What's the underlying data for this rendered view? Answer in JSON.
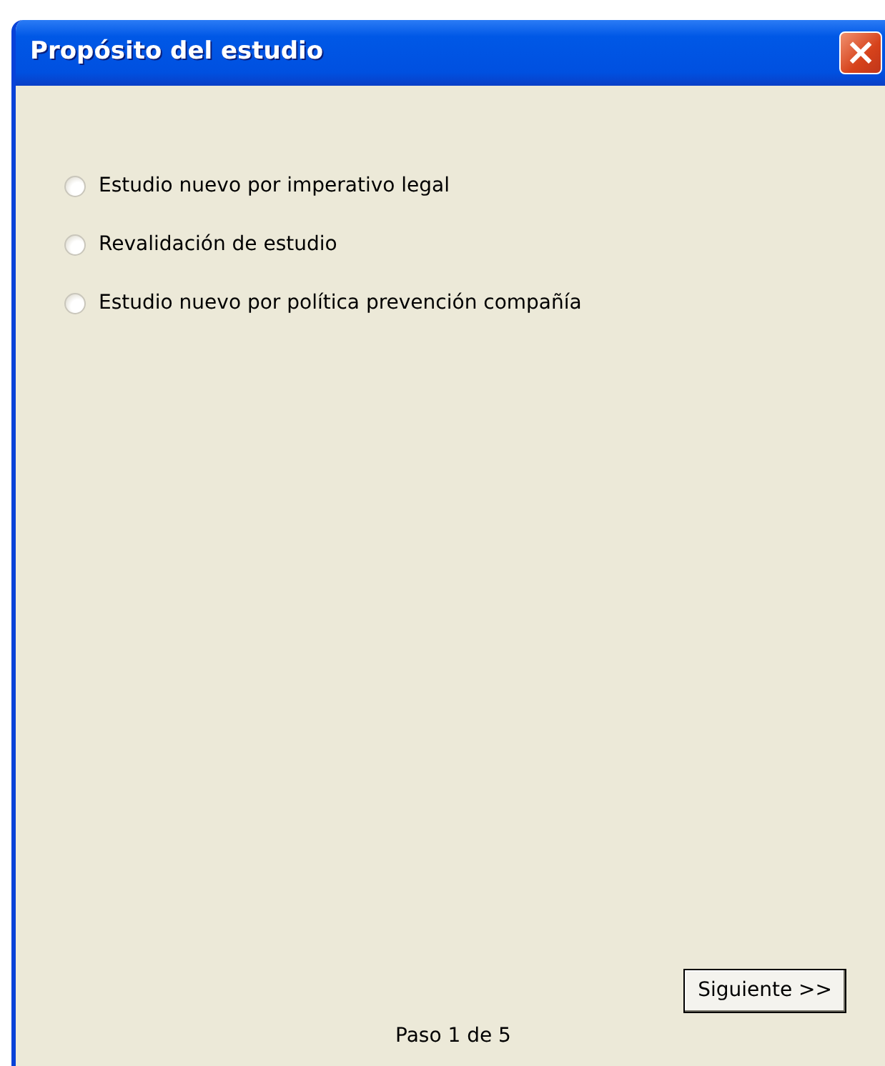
{
  "window": {
    "title": "Propósito del estudio",
    "close_button": "×"
  },
  "options": [
    {
      "label": "Estudio nuevo por imperativo legal",
      "selected": false
    },
    {
      "label": "Revalidación de estudio",
      "selected": false
    },
    {
      "label": "Estudio nuevo por política prevención compañía",
      "selected": false
    }
  ],
  "next_button": "Siguiente >>",
  "step": "Paso 1 de 5"
}
